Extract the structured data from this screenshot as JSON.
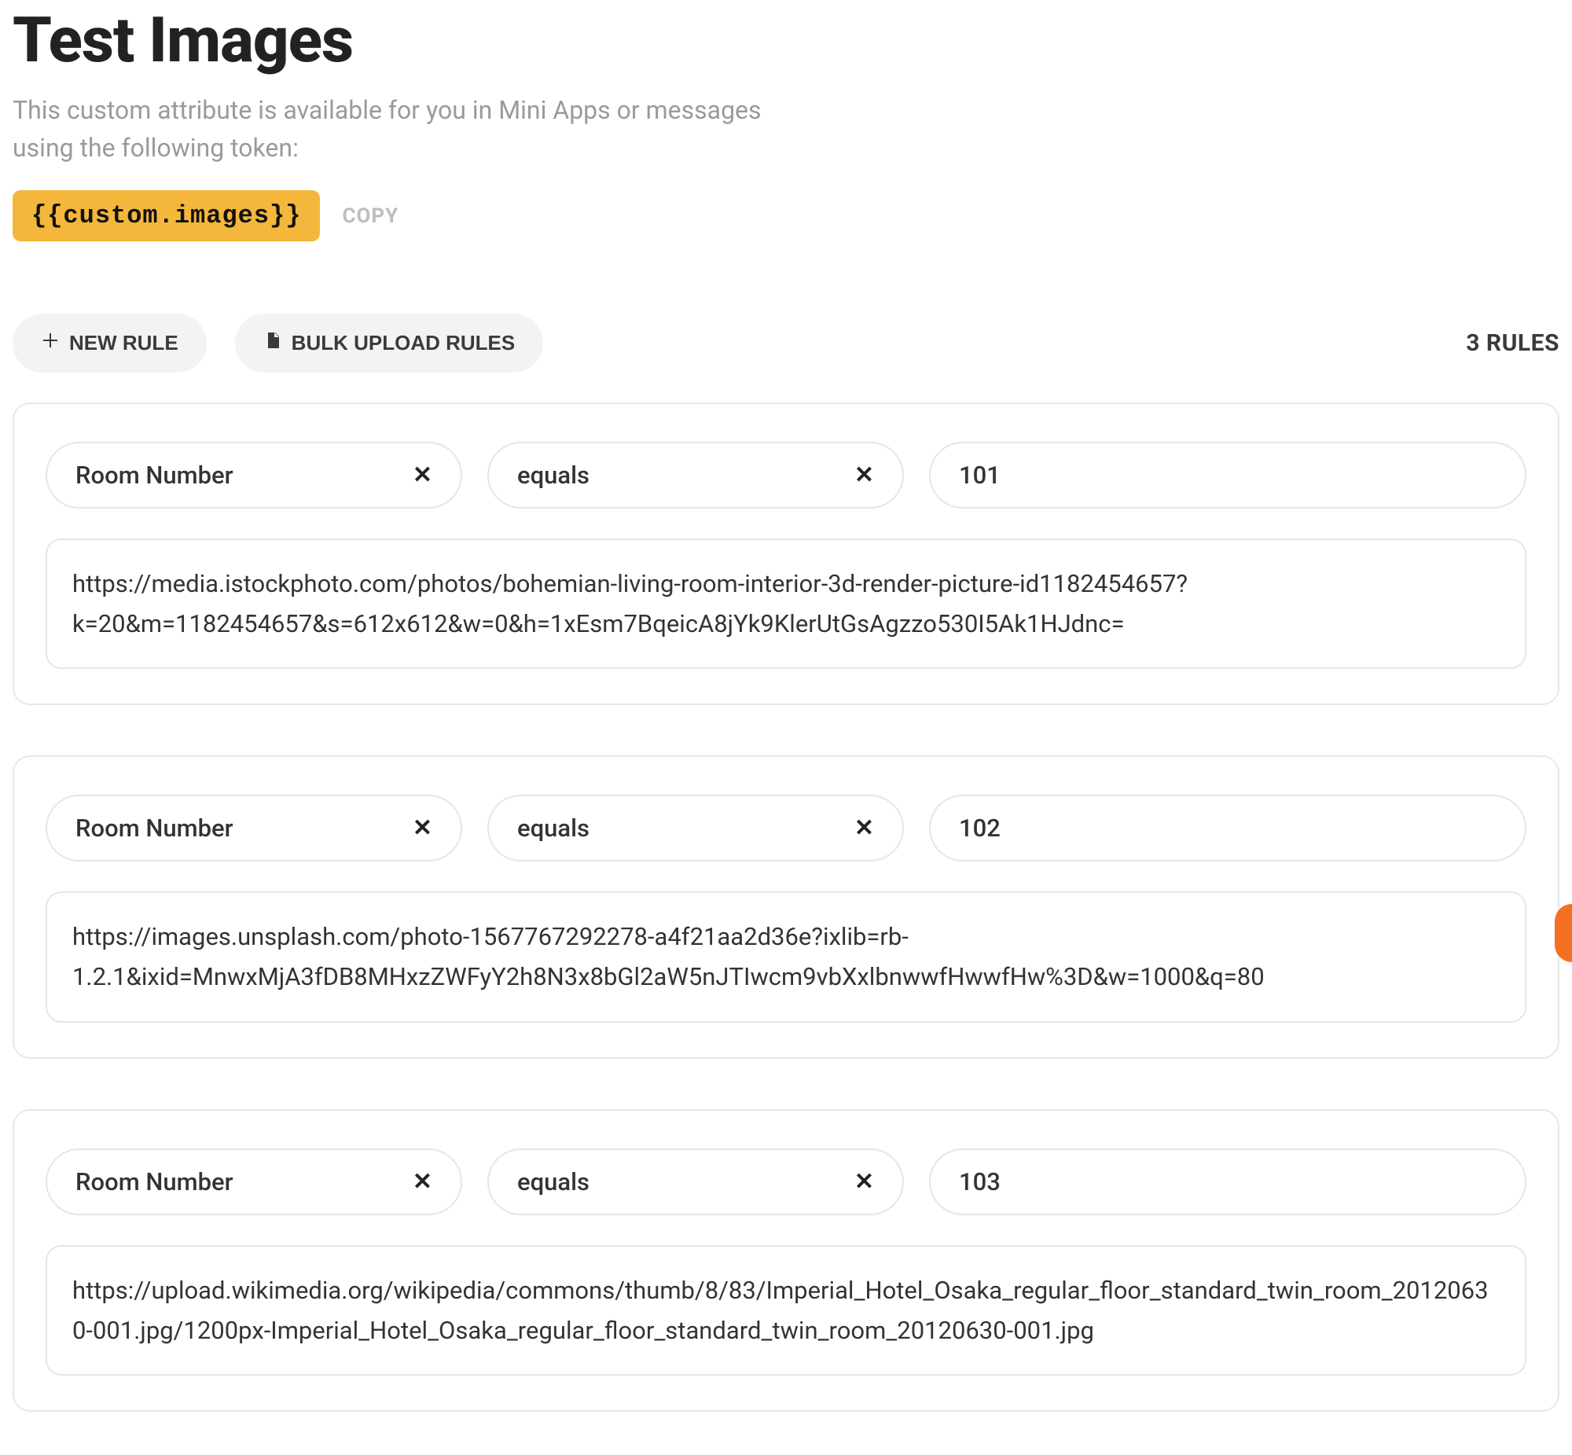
{
  "header": {
    "title": "Test Images",
    "subtitle": "This custom attribute is available for you in Mini Apps or messages using the following token:",
    "token": "{{custom.images}}",
    "copy_label": "COPY"
  },
  "buttons": {
    "new_rule": "NEW RULE",
    "bulk_upload": "BULK UPLOAD RULES"
  },
  "rules_count_label": "3 RULES",
  "selector_labels": {
    "field": "Room Number",
    "operator": "equals"
  },
  "rules": [
    {
      "field": "Room Number",
      "operator": "equals",
      "comparison": "101",
      "value": "https://media.istockphoto.com/photos/bohemian-living-room-interior-3d-render-picture-id1182454657?k=20&m=1182454657&s=612x612&w=0&h=1xEsm7BqeicA8jYk9KlerUtGsAgzzo530I5Ak1HJdnc="
    },
    {
      "field": "Room Number",
      "operator": "equals",
      "comparison": "102",
      "value": "https://images.unsplash.com/photo-1567767292278-a4f21aa2d36e?ixlib=rb-1.2.1&ixid=MnwxMjA3fDB8MHxzZWFyY2h8N3x8bGl2aW5nJTIwcm9vbXxlbnwwfHwwfHw%3D&w=1000&q=80"
    },
    {
      "field": "Room Number",
      "operator": "equals",
      "comparison": "103",
      "value": "https://upload.wikimedia.org/wikipedia/commons/thumb/8/83/Imperial_Hotel_Osaka_regular_floor_standard_twin_room_20120630-001.jpg/1200px-Imperial_Hotel_Osaka_regular_floor_standard_twin_room_20120630-001.jpg"
    }
  ]
}
